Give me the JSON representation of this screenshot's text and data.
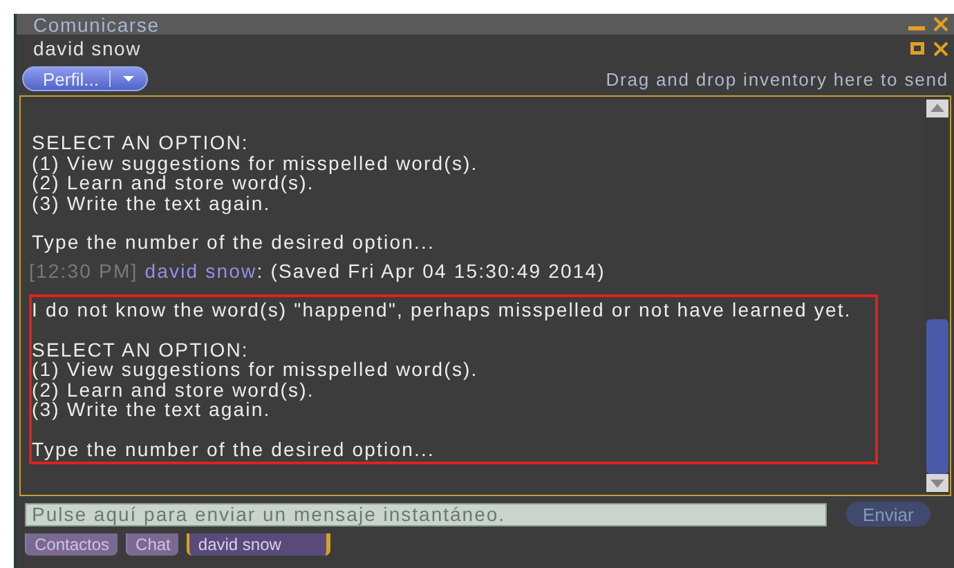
{
  "window": {
    "title": "Comunicarse"
  },
  "conversation": {
    "name": "david snow",
    "profile_button": "Perfil...",
    "drop_hint": "Drag and drop inventory here to send"
  },
  "messages": [
    {
      "kind": "system",
      "highlighted": false,
      "paragraphs": [
        [
          "SELECT AN OPTION:",
          "(1) View suggestions for misspelled word(s).",
          "(2) Learn and store word(s).",
          "(3) Write the text again."
        ],
        [
          "Type the number of the desired option..."
        ]
      ]
    },
    {
      "kind": "chat",
      "time": "[12:30 PM]",
      "sender": "david snow",
      "text": ": (Saved Fri Apr 04 15:30:49 2014)"
    },
    {
      "kind": "system",
      "highlighted": true,
      "paragraphs": [
        [
          "I do not know the word(s) \"happend\", perhaps misspelled or not have learned yet."
        ],
        [
          "SELECT AN OPTION:",
          "(1) View suggestions for misspelled word(s).",
          "(2) Learn and store word(s).",
          "(3) Write the text again."
        ],
        [
          "Type the number of the desired option..."
        ]
      ]
    }
  ],
  "input": {
    "placeholder": "Pulse aquí para enviar un mensaje instantáneo."
  },
  "send_button": "Enviar",
  "tabs": [
    {
      "label": "Contactos",
      "selected": false
    },
    {
      "label": "Chat",
      "selected": false
    },
    {
      "label": "david snow",
      "selected": true
    }
  ]
}
